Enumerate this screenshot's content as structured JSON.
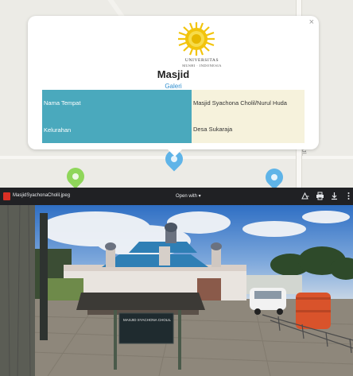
{
  "map": {
    "street_label": "Jl."
  },
  "popup": {
    "close_label": "×",
    "logo": {
      "line1": "UNIVERSITAS",
      "line2": "MUSHI · INDONESIA"
    },
    "title": "Masjid",
    "gallery_link": "Galeri",
    "rows": [
      {
        "key": "Nama Tempat",
        "value": "Masjid Syachona Cholil/Nurul Huda"
      },
      {
        "key": "Kelurahan",
        "value": "Desa Sukaraja"
      }
    ]
  },
  "viewer": {
    "file_name": "MasjidSyachonaCholil.jpeg",
    "open_with_label": "Open with ▾",
    "icons": [
      "add-to-drive-icon",
      "print-icon",
      "download-icon",
      "more-icon"
    ],
    "sign_text": "MASJID SYACHONA CHOLIL"
  },
  "colors": {
    "table_key_bg": "#4aa9bd",
    "table_value_bg": "#f6f2dc",
    "gallery_link": "#2f8fd0",
    "viewer_bar": "#202124"
  }
}
